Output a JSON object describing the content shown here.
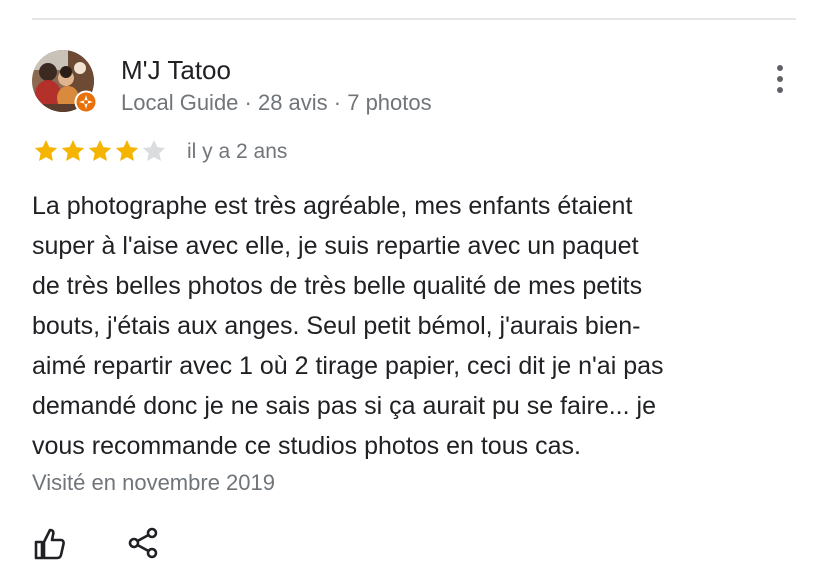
{
  "reviewer": {
    "name": "M'J Tatoo",
    "meta": "Local Guide · 28 avis · 7 photos"
  },
  "review": {
    "rating": 4,
    "rating_max": 5,
    "date": "il y a 2 ans",
    "text_lines": [
      "La photographe est très agréable, mes enfants étaient",
      "super à l'aise avec elle, je suis repartie avec un paquet",
      "de très belles photos de très belle qualité de mes petits",
      "bouts, j'étais aux anges. Seul petit bémol, j'aurais bien-",
      "aimé repartir avec 1 où 2 tirage papier, ceci dit je n'ai pas",
      "demandé donc je ne sais pas si ça aurait pu se faire... je",
      "vous recommande ce studios photos en tous cas."
    ],
    "visited": "Visité en novembre 2019"
  },
  "icons": {
    "menu": "more-vertical-icon",
    "badge": "local-guide-badge-icon",
    "like": "thumbs-up-icon",
    "share": "share-icon"
  },
  "colors": {
    "star_filled": "#f4b400",
    "star_empty": "#dadce0",
    "badge": "#e8710a",
    "secondary_text": "#70757a"
  }
}
